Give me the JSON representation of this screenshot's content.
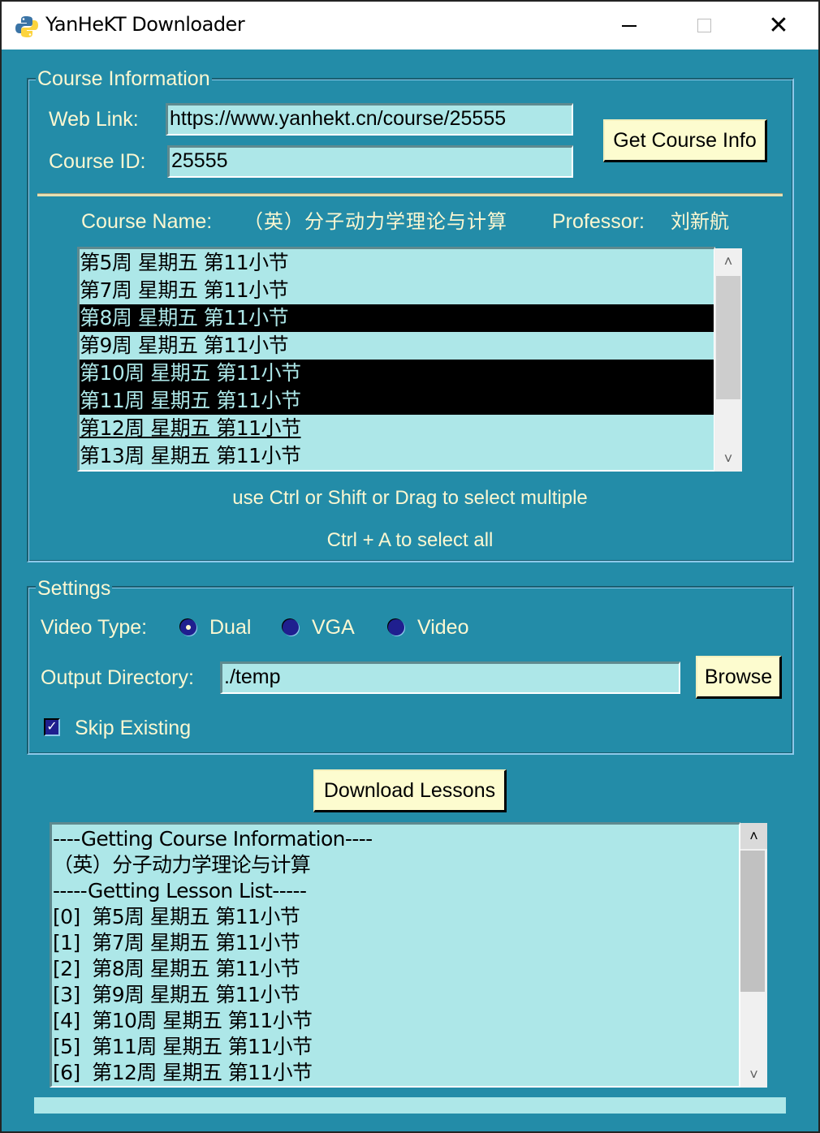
{
  "window": {
    "title": "YanHeKT Downloader",
    "icon": "python-icon",
    "controls": {
      "minimize": "minimize-icon",
      "maximize": "maximize-icon",
      "close": "✕"
    }
  },
  "course_info": {
    "group_title": "Course Information",
    "web_link_label": "Web Link:",
    "web_link_value": "https://www.yanhekt.cn/course/25555",
    "course_id_label": "Course ID:",
    "course_id_value": "25555",
    "get_info_button": "Get Course Info",
    "course_name_label": "Course Name:",
    "course_name_value": "（英）分子动力学理论与计算",
    "professor_label": "Professor:",
    "professor_value": "刘新航",
    "lessons": [
      {
        "label": "第5周 星期五 第11小节",
        "selected": false,
        "active": false
      },
      {
        "label": "第7周 星期五 第11小节",
        "selected": false,
        "active": false
      },
      {
        "label": "第8周 星期五 第11小节",
        "selected": true,
        "active": false
      },
      {
        "label": "第9周 星期五 第11小节",
        "selected": false,
        "active": false
      },
      {
        "label": "第10周 星期五 第11小节",
        "selected": true,
        "active": false
      },
      {
        "label": "第11周 星期五 第11小节",
        "selected": true,
        "active": false
      },
      {
        "label": "第12周 星期五 第11小节",
        "selected": false,
        "active": true
      },
      {
        "label": "第13周 星期五 第11小节",
        "selected": false,
        "active": false
      }
    ],
    "hint_multi": "use Ctrl or Shift or Drag to select multiple",
    "hint_all": "Ctrl + A to select all"
  },
  "settings": {
    "group_title": "Settings",
    "video_type_label": "Video Type:",
    "video_types": [
      {
        "label": "Dual",
        "checked": true
      },
      {
        "label": "VGA",
        "checked": false
      },
      {
        "label": "Video",
        "checked": false
      }
    ],
    "output_dir_label": "Output Directory:",
    "output_dir_value": "./temp",
    "browse_button": "Browse",
    "skip_existing_label": "Skip Existing",
    "skip_existing_checked": true
  },
  "download_button": "Download Lessons",
  "log": {
    "lines": [
      "----Getting Course Information----",
      "（英）分子动力学理论与计算",
      "-----Getting Lesson List-----",
      "[0]  第5周 星期五 第11小节",
      "[1]  第7周 星期五 第11小节",
      "[2]  第8周 星期五 第11小节",
      "[3]  第9周 星期五 第11小节",
      "[4]  第10周 星期五 第11小节",
      "[5]  第11周 星期五 第11小节",
      "[6]  第12周 星期五 第11小节"
    ]
  },
  "progress": {
    "percent": 0
  }
}
